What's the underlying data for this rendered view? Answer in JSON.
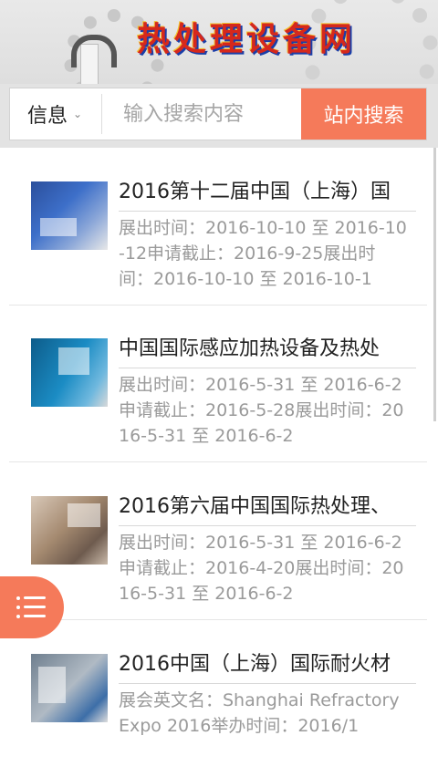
{
  "header": {
    "title": "热处理设备网"
  },
  "search": {
    "category": "信息",
    "placeholder": "输入搜索内容",
    "button_label": "站内搜索"
  },
  "items": [
    {
      "title": "2016第十二届中国（上海）国",
      "desc": "展出时间：2016-10-10 至 2016-10-12申请截止：2016-9-25展出时间：2016-10-10 至 2016-10-1"
    },
    {
      "title": "中国国际感应加热设备及热处",
      "desc": "展出时间：2016-5-31 至 2016-6-2申请截止：2016-5-28展出时间：2016-5-31 至 2016-6-2"
    },
    {
      "title": "2016第六届中国国际热处理、",
      "desc": "展出时间：2016-5-31 至 2016-6-2申请截止：2016-4-20展出时间：2016-5-31 至 2016-6-2"
    },
    {
      "title": "2016中国（上海）国际耐火材",
      "desc": "展会英文名：Shanghai Refractory Expo 2016举办时间：2016/1"
    }
  ],
  "colors": {
    "accent": "#f57a5a",
    "title_red": "#d6281c"
  },
  "icons": {
    "menu": "menu-icon",
    "chevron": "chevron-down-icon"
  }
}
